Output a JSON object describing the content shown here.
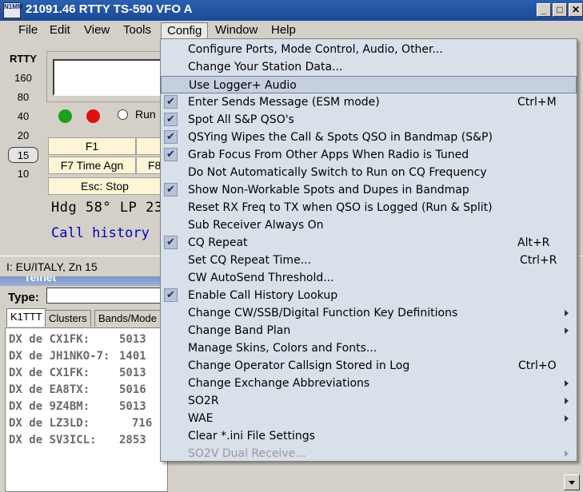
{
  "window": {
    "title": "21091.46 RTTY TS-590 VFO A",
    "icon_text": "N1MM"
  },
  "menubar": {
    "items": [
      "File",
      "Edit",
      "View",
      "Tools",
      "Config",
      "Window",
      "Help"
    ]
  },
  "mode_label": "RTTY",
  "bands": [
    "160",
    "80",
    "40",
    "20",
    "15",
    "10"
  ],
  "selected_band": "15",
  "run_label": "Run",
  "function_keys": [
    "F1",
    "F7 Time Agn",
    "F8",
    "Esc: Stop"
  ],
  "heading_text": "Hdg 58° LP 23",
  "call_history_text": "Call history",
  "status_text": "I: EU/ITALY, Zn 15",
  "telnet": {
    "title": "Telnet",
    "type_label": "Type:",
    "tabs": [
      "K1TTT",
      "Clusters",
      "Bands/Mode"
    ],
    "spots": [
      [
        "DX de CX1FK:",
        "5013"
      ],
      [
        "DX de JH1NKO-7:",
        "1401"
      ],
      [
        "DX de CX1FK:",
        "5013"
      ],
      [
        "DX de EA8TX:",
        "5016"
      ],
      [
        "DX de 9Z4BM:",
        "5013"
      ],
      [
        "DX de LZ3LD:",
        "716"
      ],
      [
        "DX de SV3ICL:",
        "2853"
      ]
    ]
  },
  "config_menu": {
    "items": [
      {
        "label": "Configure Ports, Mode Control, Audio, Other...",
        "checked": false,
        "shortcut": "",
        "submenu": false
      },
      {
        "label": "Change Your Station Data...",
        "checked": false,
        "shortcut": "",
        "submenu": false
      },
      {
        "label": "Use Logger+ Audio",
        "checked": false,
        "shortcut": "",
        "submenu": false,
        "highlighted": true
      },
      {
        "label": "Enter Sends Message (ESM mode)",
        "checked": true,
        "shortcut": "Ctrl+M",
        "submenu": false
      },
      {
        "label": "Spot All S&P QSO's",
        "checked": true,
        "shortcut": "",
        "submenu": false
      },
      {
        "label": "QSYing Wipes the Call & Spots QSO in Bandmap (S&P)",
        "checked": true,
        "shortcut": "",
        "submenu": false
      },
      {
        "label": "Grab Focus From Other Apps When Radio is Tuned",
        "checked": true,
        "shortcut": "",
        "submenu": false
      },
      {
        "label": "Do Not Automatically Switch to Run on CQ Frequency",
        "checked": false,
        "shortcut": "",
        "submenu": false
      },
      {
        "label": "Show Non-Workable Spots and Dupes in Bandmap",
        "checked": true,
        "shortcut": "",
        "submenu": false
      },
      {
        "label": "Reset RX Freq to TX when QSO is Logged (Run & Split)",
        "checked": false,
        "shortcut": "",
        "submenu": false
      },
      {
        "label": "Sub Receiver Always On",
        "checked": false,
        "shortcut": "",
        "submenu": false
      },
      {
        "label": "CQ Repeat",
        "checked": true,
        "shortcut": "Alt+R",
        "submenu": false
      },
      {
        "label": "Set CQ Repeat Time...",
        "checked": false,
        "shortcut": "Ctrl+R",
        "submenu": false
      },
      {
        "label": "CW AutoSend Threshold...",
        "checked": false,
        "shortcut": "",
        "submenu": false
      },
      {
        "label": "Enable Call History Lookup",
        "checked": true,
        "shortcut": "",
        "submenu": false
      },
      {
        "label": "Change CW/SSB/Digital Function Key Definitions",
        "checked": false,
        "shortcut": "",
        "submenu": true
      },
      {
        "label": "Change Band Plan",
        "checked": false,
        "shortcut": "",
        "submenu": true
      },
      {
        "label": "Manage Skins, Colors and Fonts...",
        "checked": false,
        "shortcut": "",
        "submenu": false
      },
      {
        "label": "Change Operator Callsign Stored in Log",
        "checked": false,
        "shortcut": "Ctrl+O",
        "submenu": false
      },
      {
        "label": "Change Exchange Abbreviations",
        "checked": false,
        "shortcut": "",
        "submenu": true
      },
      {
        "label": "SO2R",
        "checked": false,
        "shortcut": "",
        "submenu": true
      },
      {
        "label": "WAE",
        "checked": false,
        "shortcut": "",
        "submenu": true
      },
      {
        "label": "Clear *.ini File Settings",
        "checked": false,
        "shortcut": "",
        "submenu": false
      },
      {
        "label": "SO2V Dual Receive...",
        "checked": false,
        "shortcut": "",
        "submenu": true,
        "disabled": true
      }
    ]
  },
  "colors": {
    "titlebar": "#2a5fb0",
    "menu_bg": "#d8e0ea",
    "led_green": "#1aa01a",
    "led_red": "#e01010",
    "fkey_bg": "#fdf5d6",
    "call_history": "#0000c0"
  },
  "icons": {
    "minimize": "minimize-icon",
    "maximize": "maximize-icon",
    "close": "close-icon",
    "check": "check-icon",
    "submenu": "chevron-right-icon"
  }
}
